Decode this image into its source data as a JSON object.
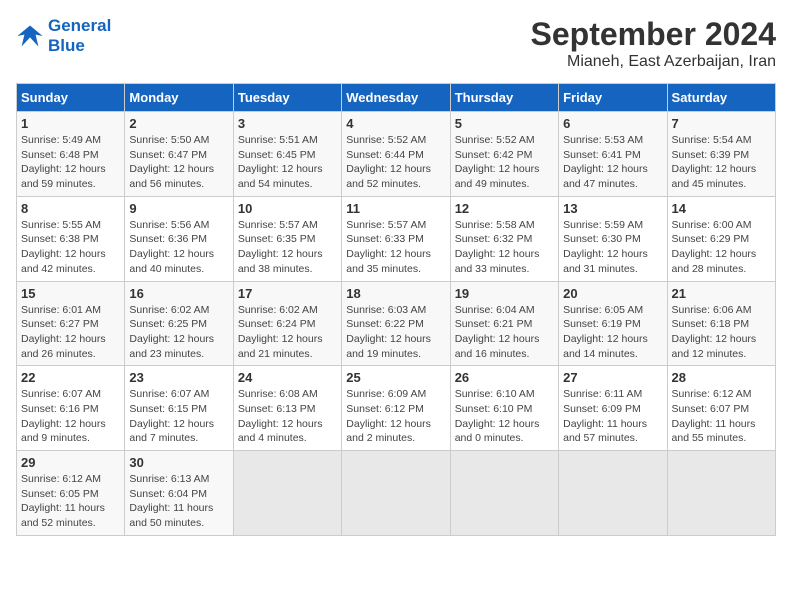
{
  "header": {
    "logo_line1": "General",
    "logo_line2": "Blue",
    "title": "September 2024",
    "subtitle": "Mianeh, East Azerbaijan, Iran"
  },
  "weekdays": [
    "Sunday",
    "Monday",
    "Tuesday",
    "Wednesday",
    "Thursday",
    "Friday",
    "Saturday"
  ],
  "weeks": [
    [
      {
        "day": "1",
        "lines": [
          "Sunrise: 5:49 AM",
          "Sunset: 6:48 PM",
          "Daylight: 12 hours",
          "and 59 minutes."
        ]
      },
      {
        "day": "2",
        "lines": [
          "Sunrise: 5:50 AM",
          "Sunset: 6:47 PM",
          "Daylight: 12 hours",
          "and 56 minutes."
        ]
      },
      {
        "day": "3",
        "lines": [
          "Sunrise: 5:51 AM",
          "Sunset: 6:45 PM",
          "Daylight: 12 hours",
          "and 54 minutes."
        ]
      },
      {
        "day": "4",
        "lines": [
          "Sunrise: 5:52 AM",
          "Sunset: 6:44 PM",
          "Daylight: 12 hours",
          "and 52 minutes."
        ]
      },
      {
        "day": "5",
        "lines": [
          "Sunrise: 5:52 AM",
          "Sunset: 6:42 PM",
          "Daylight: 12 hours",
          "and 49 minutes."
        ]
      },
      {
        "day": "6",
        "lines": [
          "Sunrise: 5:53 AM",
          "Sunset: 6:41 PM",
          "Daylight: 12 hours",
          "and 47 minutes."
        ]
      },
      {
        "day": "7",
        "lines": [
          "Sunrise: 5:54 AM",
          "Sunset: 6:39 PM",
          "Daylight: 12 hours",
          "and 45 minutes."
        ]
      }
    ],
    [
      {
        "day": "8",
        "lines": [
          "Sunrise: 5:55 AM",
          "Sunset: 6:38 PM",
          "Daylight: 12 hours",
          "and 42 minutes."
        ]
      },
      {
        "day": "9",
        "lines": [
          "Sunrise: 5:56 AM",
          "Sunset: 6:36 PM",
          "Daylight: 12 hours",
          "and 40 minutes."
        ]
      },
      {
        "day": "10",
        "lines": [
          "Sunrise: 5:57 AM",
          "Sunset: 6:35 PM",
          "Daylight: 12 hours",
          "and 38 minutes."
        ]
      },
      {
        "day": "11",
        "lines": [
          "Sunrise: 5:57 AM",
          "Sunset: 6:33 PM",
          "Daylight: 12 hours",
          "and 35 minutes."
        ]
      },
      {
        "day": "12",
        "lines": [
          "Sunrise: 5:58 AM",
          "Sunset: 6:32 PM",
          "Daylight: 12 hours",
          "and 33 minutes."
        ]
      },
      {
        "day": "13",
        "lines": [
          "Sunrise: 5:59 AM",
          "Sunset: 6:30 PM",
          "Daylight: 12 hours",
          "and 31 minutes."
        ]
      },
      {
        "day": "14",
        "lines": [
          "Sunrise: 6:00 AM",
          "Sunset: 6:29 PM",
          "Daylight: 12 hours",
          "and 28 minutes."
        ]
      }
    ],
    [
      {
        "day": "15",
        "lines": [
          "Sunrise: 6:01 AM",
          "Sunset: 6:27 PM",
          "Daylight: 12 hours",
          "and 26 minutes."
        ]
      },
      {
        "day": "16",
        "lines": [
          "Sunrise: 6:02 AM",
          "Sunset: 6:25 PM",
          "Daylight: 12 hours",
          "and 23 minutes."
        ]
      },
      {
        "day": "17",
        "lines": [
          "Sunrise: 6:02 AM",
          "Sunset: 6:24 PM",
          "Daylight: 12 hours",
          "and 21 minutes."
        ]
      },
      {
        "day": "18",
        "lines": [
          "Sunrise: 6:03 AM",
          "Sunset: 6:22 PM",
          "Daylight: 12 hours",
          "and 19 minutes."
        ]
      },
      {
        "day": "19",
        "lines": [
          "Sunrise: 6:04 AM",
          "Sunset: 6:21 PM",
          "Daylight: 12 hours",
          "and 16 minutes."
        ]
      },
      {
        "day": "20",
        "lines": [
          "Sunrise: 6:05 AM",
          "Sunset: 6:19 PM",
          "Daylight: 12 hours",
          "and 14 minutes."
        ]
      },
      {
        "day": "21",
        "lines": [
          "Sunrise: 6:06 AM",
          "Sunset: 6:18 PM",
          "Daylight: 12 hours",
          "and 12 minutes."
        ]
      }
    ],
    [
      {
        "day": "22",
        "lines": [
          "Sunrise: 6:07 AM",
          "Sunset: 6:16 PM",
          "Daylight: 12 hours",
          "and 9 minutes."
        ]
      },
      {
        "day": "23",
        "lines": [
          "Sunrise: 6:07 AM",
          "Sunset: 6:15 PM",
          "Daylight: 12 hours",
          "and 7 minutes."
        ]
      },
      {
        "day": "24",
        "lines": [
          "Sunrise: 6:08 AM",
          "Sunset: 6:13 PM",
          "Daylight: 12 hours",
          "and 4 minutes."
        ]
      },
      {
        "day": "25",
        "lines": [
          "Sunrise: 6:09 AM",
          "Sunset: 6:12 PM",
          "Daylight: 12 hours",
          "and 2 minutes."
        ]
      },
      {
        "day": "26",
        "lines": [
          "Sunrise: 6:10 AM",
          "Sunset: 6:10 PM",
          "Daylight: 12 hours",
          "and 0 minutes."
        ]
      },
      {
        "day": "27",
        "lines": [
          "Sunrise: 6:11 AM",
          "Sunset: 6:09 PM",
          "Daylight: 11 hours",
          "and 57 minutes."
        ]
      },
      {
        "day": "28",
        "lines": [
          "Sunrise: 6:12 AM",
          "Sunset: 6:07 PM",
          "Daylight: 11 hours",
          "and 55 minutes."
        ]
      }
    ],
    [
      {
        "day": "29",
        "lines": [
          "Sunrise: 6:12 AM",
          "Sunset: 6:05 PM",
          "Daylight: 11 hours",
          "and 52 minutes."
        ]
      },
      {
        "day": "30",
        "lines": [
          "Sunrise: 6:13 AM",
          "Sunset: 6:04 PM",
          "Daylight: 11 hours",
          "and 50 minutes."
        ]
      },
      {
        "day": "",
        "lines": []
      },
      {
        "day": "",
        "lines": []
      },
      {
        "day": "",
        "lines": []
      },
      {
        "day": "",
        "lines": []
      },
      {
        "day": "",
        "lines": []
      }
    ]
  ]
}
